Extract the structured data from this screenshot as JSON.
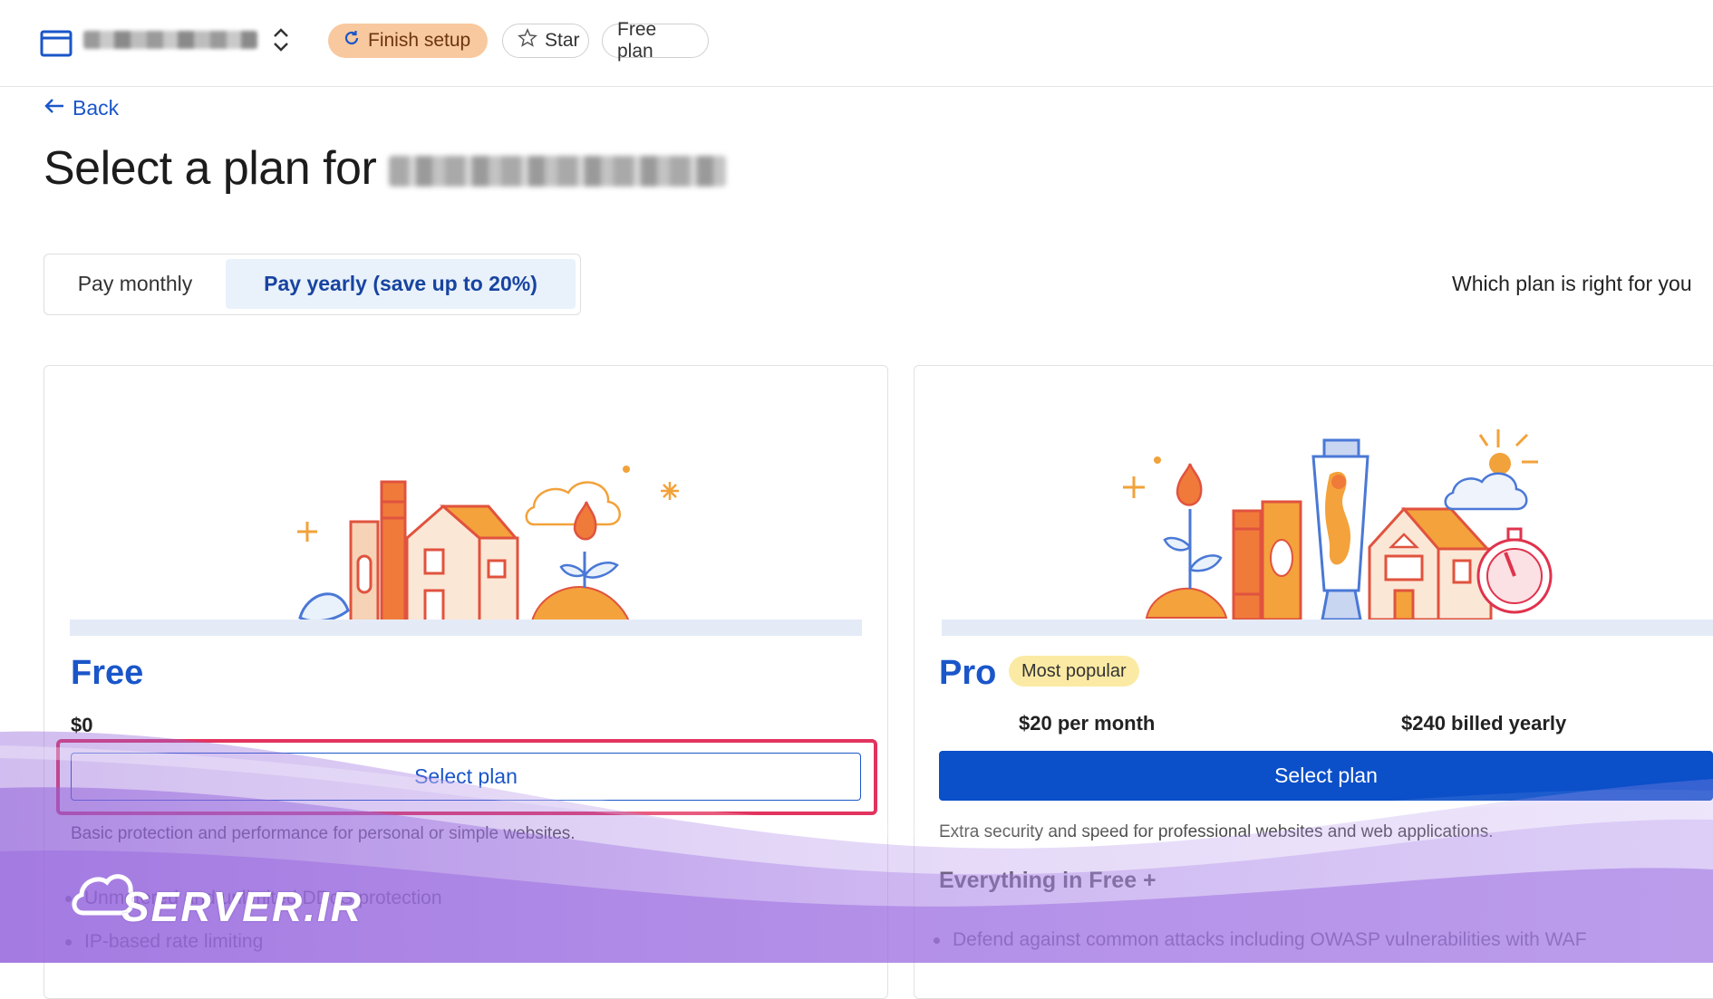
{
  "topbar": {
    "finish_setup_label": "Finish setup",
    "star_label": "Star",
    "plan_label": "Free plan"
  },
  "back_label": "Back",
  "page_title": "Select a plan for",
  "billing_toggle": {
    "monthly_label": "Pay monthly",
    "yearly_label": "Pay yearly (save up to 20%)",
    "selected": "yearly"
  },
  "which_plan_link": "Which plan is right for you",
  "plans": {
    "free": {
      "name": "Free",
      "price": "$0",
      "select_label": "Select plan",
      "description": "Basic protection and performance for personal or simple websites.",
      "features": [
        "Unmetered and unlimited DDoS protection",
        "IP-based rate limiting"
      ]
    },
    "pro": {
      "name": "Pro",
      "badge": "Most popular",
      "price_monthly": "$20 per month",
      "price_yearly": "$240 billed yearly",
      "select_label": "Select plan",
      "description": "Extra security and speed for professional websites and web applications.",
      "everything_heading": "Everything in Free +",
      "features": [
        "Defend against common attacks including OWASP vulnerabilities with WAF"
      ]
    }
  },
  "watermark": "SERVER.IR",
  "colors": {
    "accent": "#1a56c9",
    "primary_button": "#0b4fc9",
    "highlight_border": "#e2335f",
    "finish_pill": "#f8c89f",
    "badge": "#fbeaa4"
  }
}
